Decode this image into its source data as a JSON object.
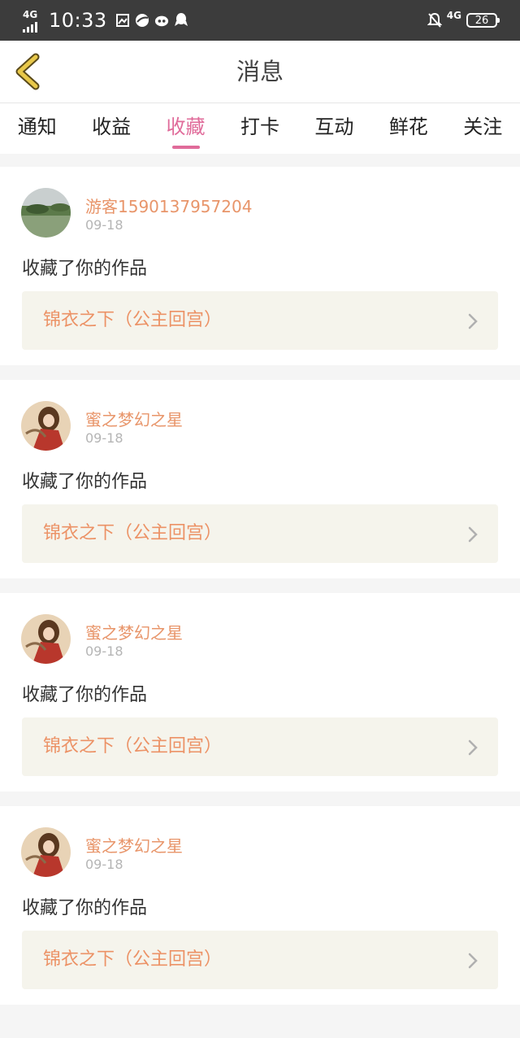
{
  "status_bar": {
    "network": "4G",
    "time": "10:33",
    "network_right": "4G",
    "battery": "26"
  },
  "header": {
    "title": "消息"
  },
  "tabs": [
    {
      "label": "通知",
      "active": false
    },
    {
      "label": "收益",
      "active": false
    },
    {
      "label": "收藏",
      "active": true
    },
    {
      "label": "打卡",
      "active": false
    },
    {
      "label": "互动",
      "active": false
    },
    {
      "label": "鲜花",
      "active": false
    },
    {
      "label": "关注",
      "active": false
    }
  ],
  "items": [
    {
      "user": "游客1590137957204",
      "date": "09-18",
      "action": "收藏了你的作品",
      "work": "锦衣之下（公主回宫）",
      "avatar": "landscape"
    },
    {
      "user": "蜜之梦幻之星",
      "date": "09-18",
      "action": "收藏了你的作品",
      "work": "锦衣之下（公主回宫）",
      "avatar": "illustration"
    },
    {
      "user": "蜜之梦幻之星",
      "date": "09-18",
      "action": "收藏了你的作品",
      "work": "锦衣之下（公主回宫）",
      "avatar": "illustration"
    },
    {
      "user": "蜜之梦幻之星",
      "date": "09-18",
      "action": "收藏了你的作品",
      "work": "锦衣之下（公主回宫）",
      "avatar": "illustration"
    }
  ],
  "colors": {
    "accent": "#e06b9a",
    "name": "#e8956a",
    "work_title": "#ec9266",
    "back_arrow": "#e0c040"
  }
}
